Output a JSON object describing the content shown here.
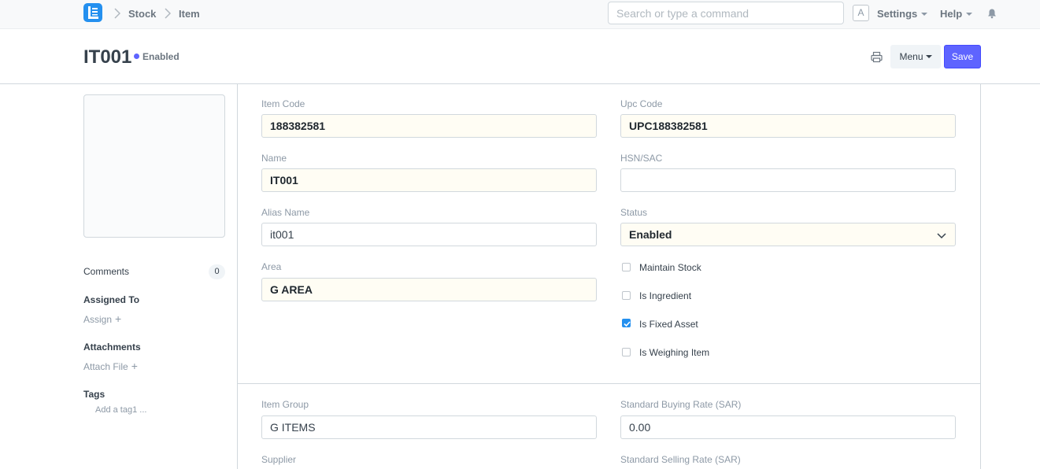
{
  "navbar": {
    "breadcrumbs": [
      "Stock",
      "Item"
    ],
    "search_placeholder": "Search or type a command",
    "avatar_letter": "A",
    "settings_label": "Settings",
    "help_label": "Help"
  },
  "header": {
    "title": "IT001",
    "status": "Enabled",
    "status_color": "#5e64ff",
    "menu_label": "Menu",
    "save_label": "Save"
  },
  "sidebar": {
    "comments_label": "Comments",
    "comments_count": "0",
    "assigned_label": "Assigned To",
    "assign_link": "Assign",
    "attachments_label": "Attachments",
    "attach_link": "Attach File",
    "tags_label": "Tags",
    "tag_placeholder": "Add a tag1 ..."
  },
  "form": {
    "item_code": {
      "label": "Item Code",
      "value": "188382581"
    },
    "upc_code": {
      "label": "Upc Code",
      "value": "UPC188382581"
    },
    "name": {
      "label": "Name",
      "value": "IT001"
    },
    "hsn_sac": {
      "label": "HSN/SAC",
      "value": ""
    },
    "alias_name": {
      "label": "Alias Name",
      "value": "it001"
    },
    "status": {
      "label": "Status",
      "value": "Enabled"
    },
    "area": {
      "label": "Area",
      "value": "G AREA"
    },
    "checkboxes": [
      {
        "label": "Maintain Stock",
        "checked": false
      },
      {
        "label": "Is Ingredient",
        "checked": false
      },
      {
        "label": "Is Fixed Asset",
        "checked": true
      },
      {
        "label": "Is Weighing Item",
        "checked": false
      }
    ],
    "item_group": {
      "label": "Item Group",
      "value": "G ITEMS"
    },
    "standard_buying_rate": {
      "label": "Standard Buying Rate (SAR)",
      "value": "0.00"
    },
    "supplier": {
      "label": "Supplier"
    },
    "standard_selling_rate": {
      "label": "Standard Selling Rate (SAR)"
    }
  },
  "colors": {
    "primary": "#5e64ff",
    "logo": "#2490ef",
    "check": "#2490ef"
  }
}
